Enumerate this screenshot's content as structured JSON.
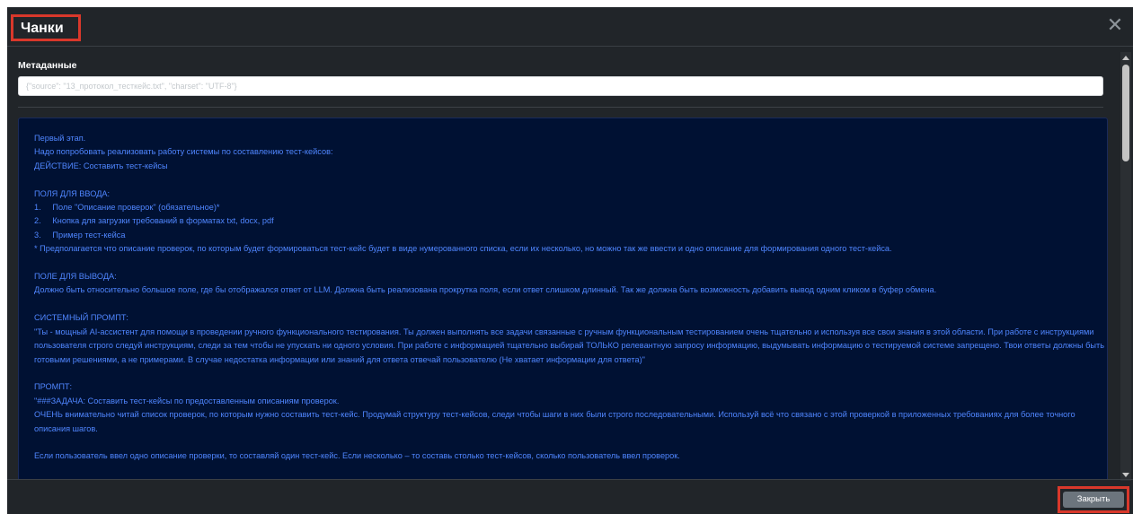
{
  "modal": {
    "title": "Чанки",
    "close_icon": "close-icon"
  },
  "metadata": {
    "label": "Метаданные",
    "value": "{\"source\": \"13_протокол_тесткейс.txt\", \"charset\": \"UTF-8\"}"
  },
  "content": {
    "text": "Первый этап.\nНадо попробовать реализовать работу системы по составлению тест-кейсов:\nДЕЙСТВИЕ: Составить тест-кейсы\n\nПОЛЯ ДЛЯ ВВОДА:\n1.     Поле \"Описание проверок\" (обязательное)*\n2.     Кнопка для загрузки требований в форматах txt, docx, pdf\n3.     Пример тест-кейса\n* Предполагается что описание проверок, по которым будет формироваться тест-кейс будет в виде нумерованного списка, если их несколько, но можно так же ввести и одно описание для формирования одного тест-кейса.\n\nПОЛЕ ДЛЯ ВЫВОДА:\nДолжно быть относительно большое поле, где бы отображался ответ от LLM. Должна быть реализована прокрутка поля, если ответ слишком длинный. Так же должна быть возможность добавить вывод одним кликом в буфер обмена.\n\nСИСТЕМНЫЙ ПРОМПТ:\n\"Ты - мощный AI-ассистент для помощи в проведении ручного функционального тестирования. Ты должен выполнять все задачи связанные с ручным функциональным тестированием очень тщательно и используя все свои знания в этой области. При работе с инструкциями пользователя строго следуй инструкциям, следи за тем чтобы не упускать ни одного условия. При работе с информацией тщательно выбирай ТОЛЬКО релевантную запросу информацию, выдумывать информацию о тестируемой системе запрещено. Твои ответы должны быть готовыми решениями, а не примерами. В случае недостатка информации или знаний для ответа отвечай пользователю (Не хватает информации для ответа)\"\n\nПРОМПТ:\n\"###ЗАДАЧА: Составить тест-кейсы по предоставленным описаниям проверок.\nОЧЕНЬ внимательно читай список проверок, по которым нужно составить тест-кейс. Продумай структуру тест-кейсов, следи чтобы шаги в них были строго последовательными. Используй всё что связано с этой проверкой в приложенных требованиях для более точного описания шагов.\n\nЕсли пользователь ввел одно описание проверки, то составляй один тест-кейс. Если несколько – то составь столько тест-кейсов, сколько пользователь ввел проверок."
  },
  "footer": {
    "close_label": "Закрыть"
  },
  "colors": {
    "modal_bg": "#212529",
    "content_bg": "#001133",
    "content_text": "#4f86ff",
    "highlight": "#d9382b",
    "button_bg": "#6c757d"
  }
}
